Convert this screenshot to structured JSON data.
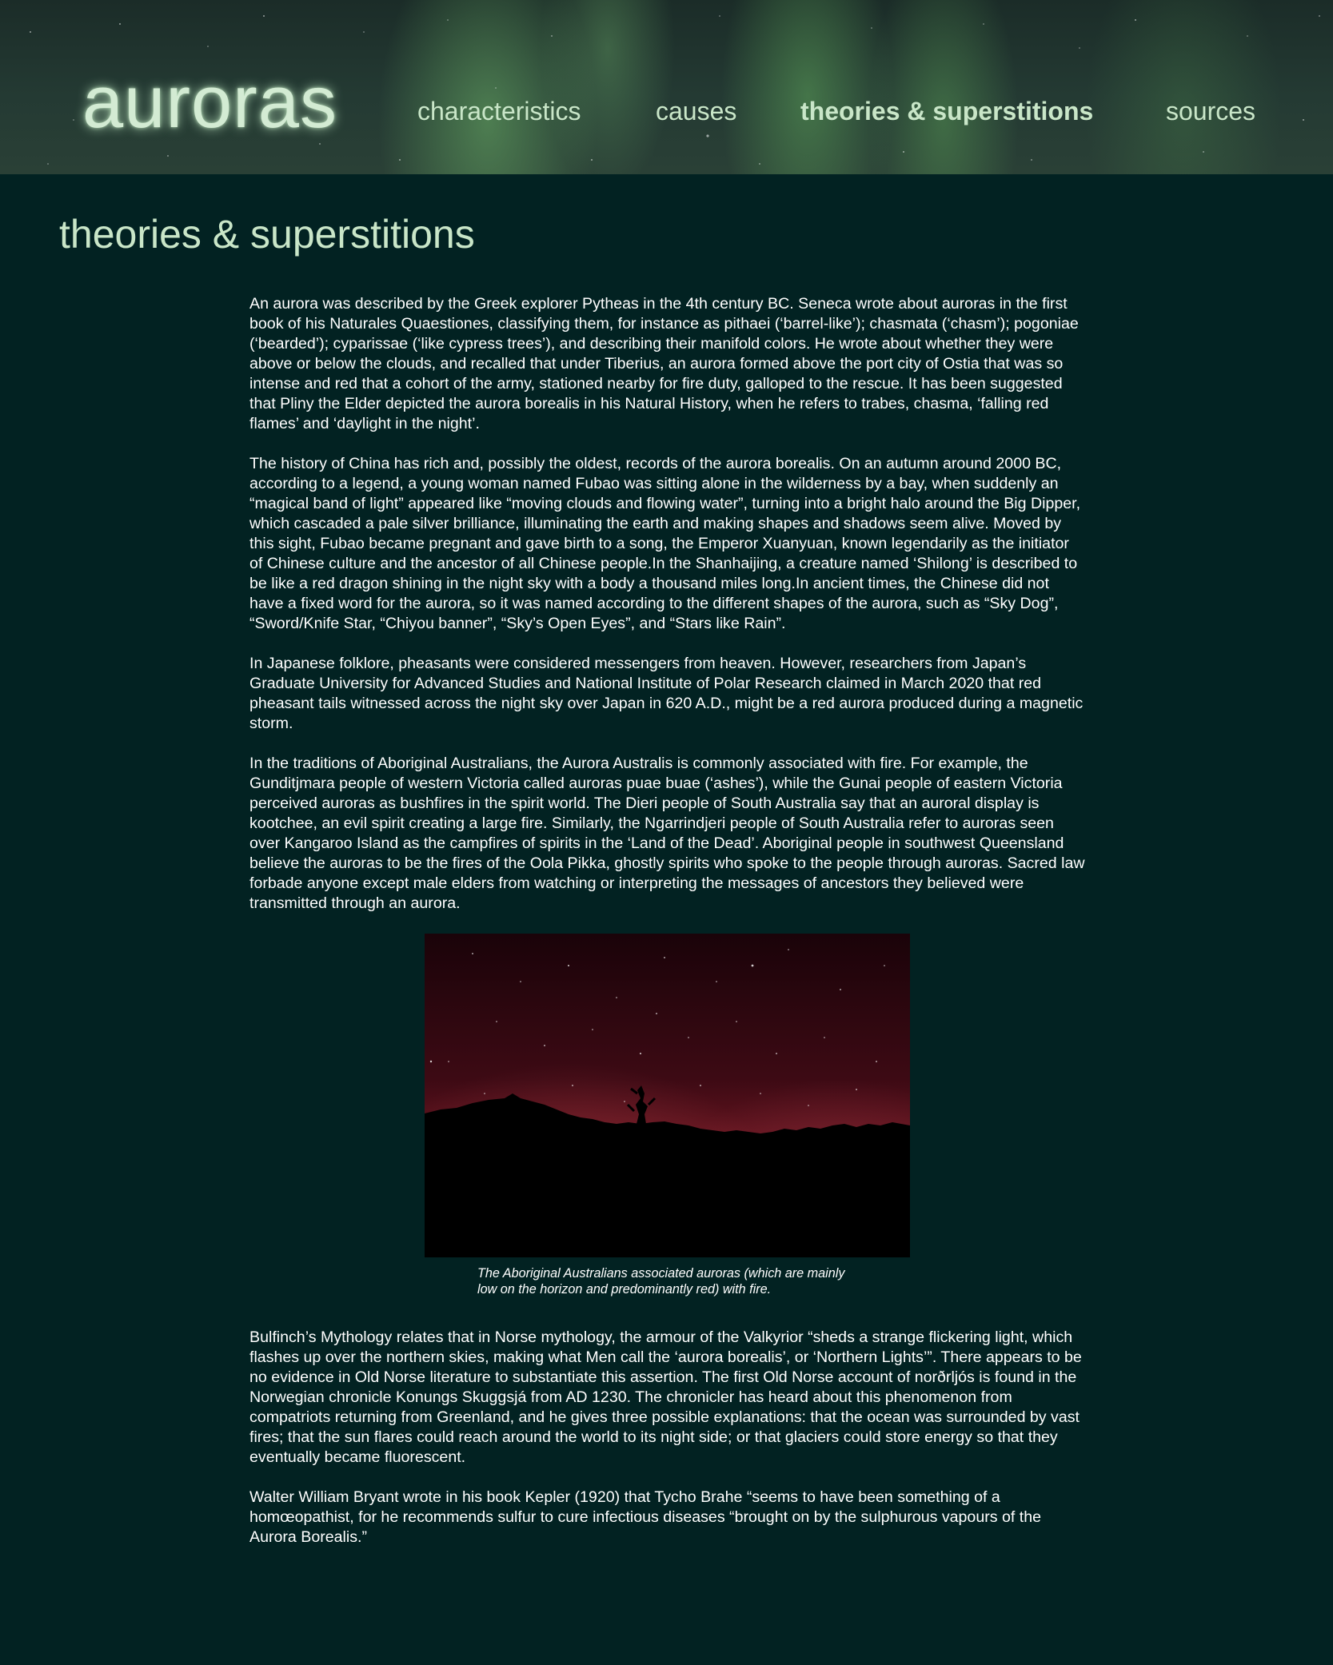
{
  "header": {
    "logo": "auroras",
    "nav": [
      {
        "label": "characteristics",
        "active": false
      },
      {
        "label": "causes",
        "active": false
      },
      {
        "label": "theories & superstitions",
        "active": true
      },
      {
        "label": "sources",
        "active": false
      }
    ]
  },
  "main": {
    "title": "theories & superstitions",
    "paragraphs_before": [
      "An aurora was described by the Greek explorer Pytheas in the 4th century BC. Seneca wrote about auroras in the first book of his Naturales Quaestiones, classifying them, for instance as pithaei (‘barrel-like’); chasmata (‘chasm’); pogoniae (‘bearded’); cyparissae (‘like cypress trees’), and describing their manifold colors. He wrote about whether they were above or below the clouds, and recalled that under Tiberius, an aurora formed above the port city of Ostia that was so intense and red that a cohort of the army, stationed nearby for fire duty, galloped to the rescue. It has been suggested that Pliny the Elder depicted the aurora borealis in his Natural History, when he refers to trabes, chasma, ‘falling red flames’ and ‘daylight in the night’.",
      "The history of China has rich and, possibly the oldest, records of the aurora borealis. On an autumn around 2000 BC, according to a legend, a young woman named Fubao was sitting alone in the wilderness by a bay, when suddenly an “magical band of light” appeared like “moving clouds and flowing water”, turning into a bright halo around the Big Dipper, which cascaded a pale silver brilliance, illuminating the earth and making shapes and shadows seem alive. Moved by this sight, Fubao became pregnant and gave birth to a song, the Emperor Xuanyuan, known legendarily as the initiator of Chinese culture and the ancestor of all Chinese people.In the Shanhaijing, a creature named ‘Shilong’ is described to be like a red dragon shining in the night sky with a body a thousand miles long.In ancient times, the Chinese did not have a fixed word for the aurora, so it was named according to the different shapes of the aurora, such as “Sky Dog”, “Sword/Knife Star, “Chiyou banner”, “Sky’s Open Eyes”, and “Stars like Rain”.",
      "In Japanese folklore, pheasants were considered messengers from heaven. However, researchers from Japan’s Graduate University for Advanced Studies and National Institute of Polar Research claimed in March 2020 that red pheasant tails witnessed across the night sky over Japan in 620 A.D., might be a red aurora produced during a magnetic storm.",
      "In the traditions of Aboriginal Australians, the Aurora Australis is commonly associated with fire. For example, the Gunditjmara people of western Victoria called auroras puae buae (‘ashes’), while the Gunai people of eastern Victoria perceived auroras as bushfires in the spirit world. The Dieri people of South Australia say that an auroral display is kootchee, an evil spirit creating a large fire. Similarly, the Ngarrindjeri people of South Australia refer to auroras seen over Kangaroo Island as the campfires of spirits in the ‘Land of the Dead’. Aboriginal people in southwest Queensland believe the auroras to be the fires of the Oola Pikka, ghostly spirits who spoke to the people through auroras. Sacred law forbade anyone except male elders from watching or interpreting the messages of ancestors they believed were transmitted through an aurora."
    ],
    "figure": {
      "caption": "The Aboriginal Australians associated auroras (which are mainly low on the horizon and predominantly red) with fire."
    },
    "paragraphs_after": [
      "Bulfinch’s Mythology relates that in Norse mythology, the armour of the Valkyrior “sheds a strange flickering light, which flashes up over the northern skies, making what Men call the ‘aurora borealis’, or ‘Northern Lights’”. There appears to be no evidence in Old Norse literature to substantiate this assertion. The first Old Norse account of norðrljós is found in the Norwegian chronicle Konungs Skuggsjá from AD 1230. The chronicler has heard about this phenomenon from compatriots returning from Greenland, and he gives three possible explanations: that the ocean was surrounded by vast fires; that the sun flares could reach around the world to its night side; or that glaciers could store energy so that they eventually became fluorescent.",
      "Walter William Bryant wrote in his book Kepler (1920) that Tycho Brahe “seems to have been something of a homœopathist, for he recommends sulfur to cure infectious diseases “brought on by the sulphurous vapours of the Aurora Borealis.”"
    ]
  },
  "colors": {
    "page_background": "#022222",
    "accent_text": "#c9e6c8",
    "body_text": "#ffffff",
    "aurora_red": "#8a1a22"
  }
}
